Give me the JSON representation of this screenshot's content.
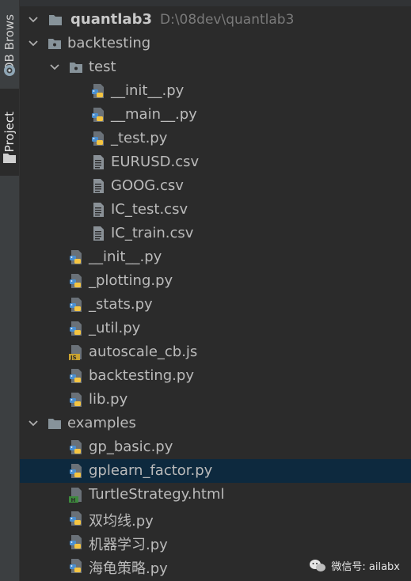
{
  "sidebar": {
    "db_tab_label": "DB Brows",
    "project_tab_label": "Project"
  },
  "tree": {
    "root": {
      "name": "quantlab3",
      "path": "D:\\08dev\\quantlab3"
    },
    "nodes": [
      {
        "label": "backtesting",
        "type": "package",
        "level": 1,
        "expanded": true
      },
      {
        "label": "test",
        "type": "package",
        "level": 2,
        "expanded": true
      },
      {
        "label": "__init__.py",
        "type": "python",
        "level": 3
      },
      {
        "label": "__main__.py",
        "type": "python",
        "level": 3
      },
      {
        "label": "_test.py",
        "type": "python",
        "level": 3
      },
      {
        "label": "EURUSD.csv",
        "type": "text",
        "level": 3
      },
      {
        "label": "GOOG.csv",
        "type": "text",
        "level": 3
      },
      {
        "label": "IC_test.csv",
        "type": "text",
        "level": 3
      },
      {
        "label": "IC_train.csv",
        "type": "text",
        "level": 3
      },
      {
        "label": "__init__.py",
        "type": "python",
        "level": 2
      },
      {
        "label": "_plotting.py",
        "type": "python",
        "level": 2
      },
      {
        "label": "_stats.py",
        "type": "python",
        "level": 2
      },
      {
        "label": "_util.py",
        "type": "python",
        "level": 2
      },
      {
        "label": "autoscale_cb.js",
        "type": "javascript",
        "level": 2
      },
      {
        "label": "backtesting.py",
        "type": "python",
        "level": 2
      },
      {
        "label": "lib.py",
        "type": "python",
        "level": 2
      },
      {
        "label": "examples",
        "type": "folder",
        "level": 1,
        "expanded": true
      },
      {
        "label": "gp_basic.py",
        "type": "python",
        "level": 2
      },
      {
        "label": "gplearn_factor.py",
        "type": "python",
        "level": 2,
        "selected": true
      },
      {
        "label": "TurtleStrategy.html",
        "type": "html",
        "level": 2
      },
      {
        "label": "双均线.py",
        "type": "python",
        "level": 2
      },
      {
        "label": "机器学习.py",
        "type": "python",
        "level": 2
      },
      {
        "label": "海龟策略.py",
        "type": "python",
        "level": 2
      }
    ]
  },
  "watermark": {
    "text": "微信号: ailabx"
  },
  "colors": {
    "background": "#2b2b2b",
    "selection": "#0d293e",
    "text": "#bbbbbb",
    "path_text": "#7a7a7a",
    "folder": "#87939a",
    "python_blue": "#4a8fd1",
    "python_yellow": "#f5c542"
  }
}
